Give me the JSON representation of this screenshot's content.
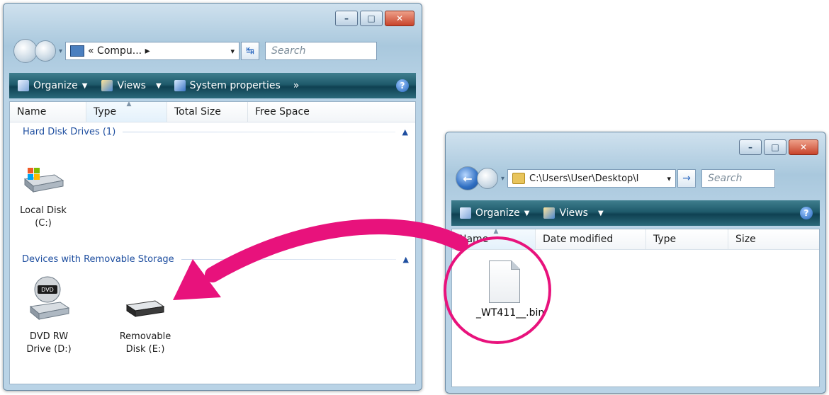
{
  "left_window": {
    "address_text": "« Compu... ▸",
    "search_placeholder": "Search",
    "toolbar": {
      "organize": "Organize",
      "views": "Views",
      "system_properties": "System properties",
      "more": "»",
      "help": "?"
    },
    "columns": [
      "Name",
      "Type",
      "Total Size",
      "Free Space"
    ],
    "groups": [
      {
        "label": "Hard Disk Drives (1)",
        "items": [
          {
            "label": "Local Disk (C:)",
            "icon": "hard-drive-icon"
          }
        ]
      },
      {
        "label": "Devices with Removable Storage",
        "items": [
          {
            "label": "DVD RW Drive (D:)",
            "icon": "dvd-drive-icon"
          },
          {
            "label": "Removable Disk (E:)",
            "icon": "removable-disk-icon"
          }
        ]
      }
    ]
  },
  "right_window": {
    "address_text": "C:\\Users\\User\\Desktop\\I",
    "search_placeholder": "Search",
    "toolbar": {
      "organize": "Organize",
      "views": "Views",
      "help": "?"
    },
    "columns": [
      "Name",
      "Date modified",
      "Type",
      "Size"
    ],
    "file": {
      "label": "_WT411__.bin",
      "icon": "file-icon"
    }
  },
  "colors": {
    "arrow": "#e8127c",
    "circle": "#e8127c",
    "toolbar": "#1f5a6b",
    "group_text": "#1f4fa0"
  }
}
